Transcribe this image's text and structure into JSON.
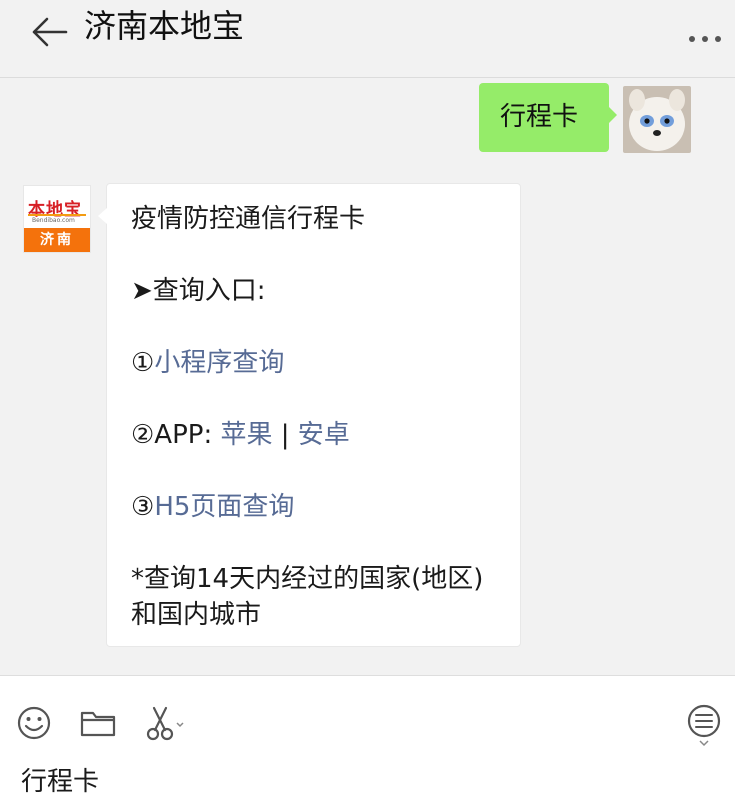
{
  "header": {
    "title": "济南本地宝",
    "back_icon": "arrow-left-icon",
    "more_icon": "more-dots-icon"
  },
  "messages": {
    "outgoing": {
      "text": "行程卡"
    },
    "incoming": {
      "avatar": {
        "logo_text": "本地宝",
        "logo_url": "Bendibao.com",
        "city": "济南"
      },
      "title": "疫情防控通信行程卡",
      "entry_label": "➤查询入口:",
      "item1_prefix": "①",
      "item1_link": "小程序查询",
      "item2_prefix": "②APP:",
      "item2_link_ios": "苹果",
      "item2_sep": " | ",
      "item2_link_android": "安卓",
      "item3_prefix": "③",
      "item3_link": "H5页面查询",
      "note_line1": "*查询14天内经过的国家(地区)",
      "note_line2": "和国内城市"
    }
  },
  "input_bar": {
    "text": "行程卡",
    "icons": [
      "emoji-icon",
      "folder-icon",
      "scissors-icon",
      "chat-history-icon"
    ]
  },
  "colors": {
    "link": "#576b95",
    "outgoing_bubble": "#95ec69",
    "background": "#f2f2f2"
  }
}
